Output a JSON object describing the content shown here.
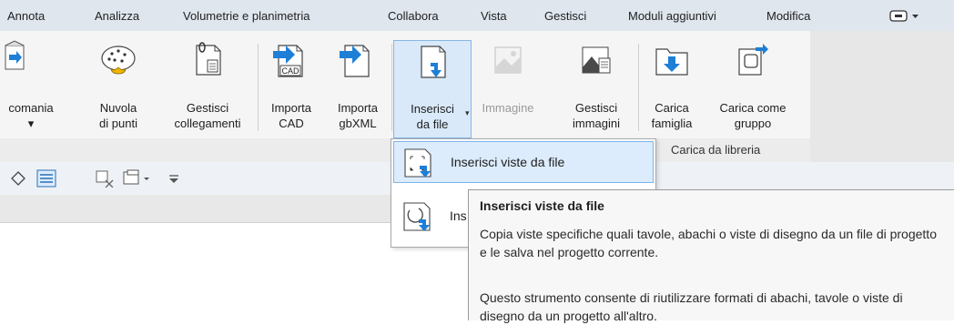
{
  "tabs": [
    "Annota",
    "Analizza",
    "Volumetrie e planimetria",
    "Collabora",
    "Vista",
    "Gestisci",
    "Moduli aggiuntivi",
    "Modifica"
  ],
  "tools": {
    "decal": {
      "line1": "comania",
      "line2": "▾",
      "icon": "decal-icon"
    },
    "point_cloud": {
      "line1": "Nuvola",
      "line2": "di punti",
      "icon": "point-cloud-icon"
    },
    "manage_links": {
      "line1": "Gestisci",
      "line2": "collegamenti",
      "icon": "manage-links-icon"
    },
    "import_cad": {
      "line1": "Importa",
      "line2": "CAD",
      "icon": "import-cad-icon",
      "badge": "CAD"
    },
    "import_gbxml": {
      "line1": "Importa",
      "line2": "gbXML",
      "icon": "import-gbxml-icon"
    },
    "insert_from_file": {
      "line1": "Inserisci",
      "line2": "da file",
      "icon": "insert-from-file-icon"
    },
    "image": {
      "line1": "Immagine",
      "line2": "",
      "icon": "image-icon"
    },
    "manage_images": {
      "line1": "Gestisci",
      "line2": "immagini",
      "icon": "manage-images-icon"
    },
    "load_family": {
      "line1": "Carica",
      "line2": "famiglia",
      "icon": "load-family-icon"
    },
    "load_as_group": {
      "line1": "Carica come",
      "line2": "gruppo",
      "icon": "load-as-group-icon"
    }
  },
  "panel": {
    "load_from_library": "Carica da libreria"
  },
  "dropdown": {
    "items": [
      {
        "label": "Inserisci viste da file",
        "icon": "insert-views-icon"
      },
      {
        "label": "Ins",
        "icon": "insert-2d-icon"
      }
    ]
  },
  "tooltip": {
    "title": "Inserisci viste da file",
    "p1": "Copia viste specifiche quali tavole, abachi o viste di disegno da un file di progetto e le salva nel progetto corrente.",
    "p2": "Questo strumento consente di riutilizzare formati di abachi, tavole o viste di disegno da un progetto all'altro."
  },
  "colors": {
    "accent": "#1e7fd6",
    "highlight": "#dcecfc"
  }
}
